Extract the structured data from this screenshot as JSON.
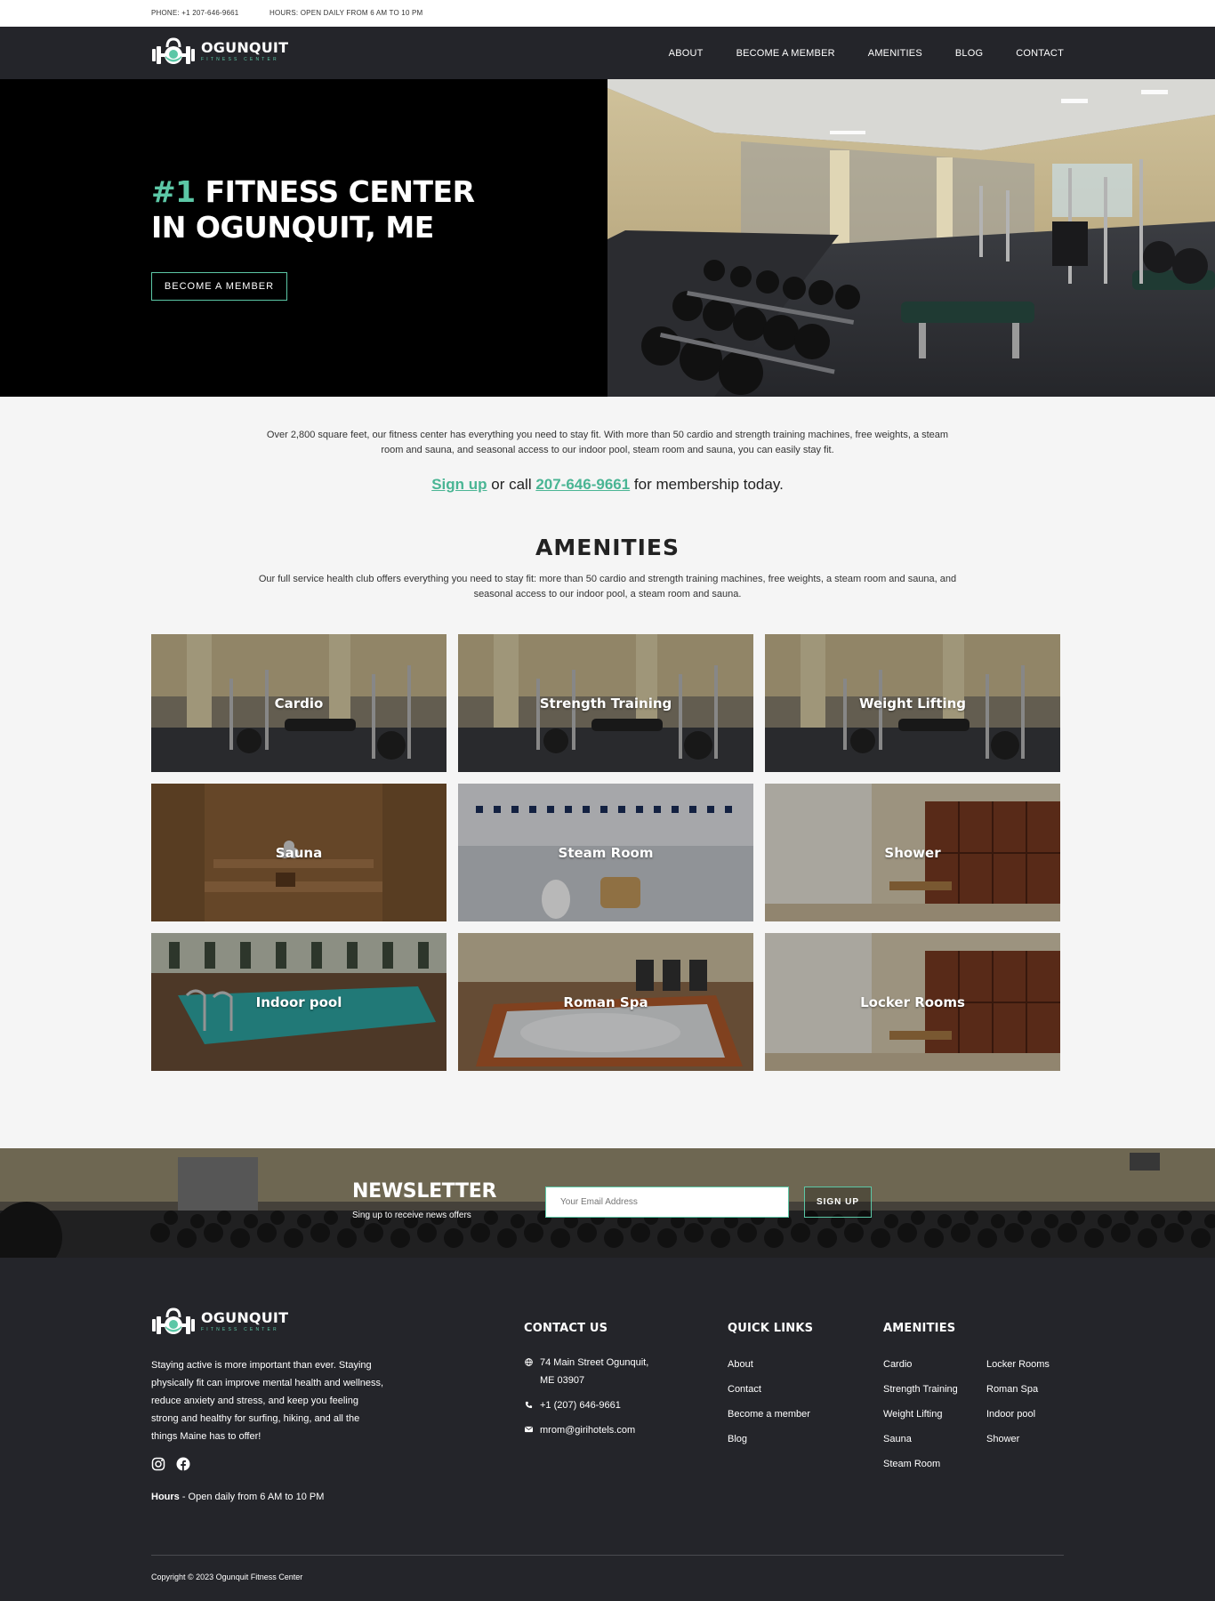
{
  "topbar": {
    "phone": "PHONE: +1 207-646-9661",
    "hours": "HOURS: OPEN DAILY FROM 6 AM TO 10 PM"
  },
  "brand": {
    "name": "OGUNQUIT",
    "tagline": "FITNESS CENTER",
    "accent_color": "#5cc7a6",
    "dark_color": "#24252a"
  },
  "nav": {
    "items": [
      "ABOUT",
      "BECOME A MEMBER",
      "AMENITIES",
      "BLOG",
      "CONTACT"
    ]
  },
  "hero": {
    "title_accent": "#1",
    "title_line1_rest": " FITNESS CENTER",
    "title_line2": "IN OGUNQUIT, ME",
    "button": "BECOME A MEMBER"
  },
  "intro": {
    "text": "Over 2,800 square feet, our fitness center has everything you need to stay fit. With more than 50 cardio and strength training machines, free weights, a steam room and sauna, and seasonal access to our indoor pool, steam room and sauna, you can easily stay fit.",
    "signup_link": "Sign up",
    "or_call": " or call ",
    "phone_link": " 207-646-9661",
    "suffix": " for membership today."
  },
  "amenities": {
    "title": "AMENITIES",
    "description": "Our full service health club offers everything you need to stay fit: more than 50 cardio and strength training machines, free weights, a steam room and sauna, and seasonal access to our indoor pool, a steam room and sauna.",
    "tiles": [
      {
        "label": "Cardio",
        "scene": "gym"
      },
      {
        "label": "Strength Training",
        "scene": "gym"
      },
      {
        "label": "Weight Lifting",
        "scene": "gym"
      },
      {
        "label": "Sauna",
        "scene": "wood"
      },
      {
        "label": "Steam Room",
        "scene": "tile"
      },
      {
        "label": "Shower",
        "scene": "locker"
      },
      {
        "label": "Indoor pool",
        "scene": "pool"
      },
      {
        "label": "Roman Spa",
        "scene": "spa"
      },
      {
        "label": "Locker Rooms",
        "scene": "locker"
      }
    ]
  },
  "newsletter": {
    "title": "NEWSLETTER",
    "subtitle": "Sing up to receive news offers",
    "placeholder": "Your Email Address",
    "button": "SIGN UP"
  },
  "footer": {
    "about": "Staying active is more important than ever. Staying physically fit can improve mental health and wellness, reduce anxiety and stress, and keep you feeling strong and healthy for surfing, hiking, and all the things Maine has to offer!",
    "hours_label": "Hours",
    "hours_text": " - Open daily from 6 AM to 10 PM",
    "contact_title": "CONTACT US",
    "address_line1": "74 Main Street Ogunquit,",
    "address_line2": "ME 03907",
    "phone": "+1 (207) 646-9661",
    "email": "mrom@girihotels.com",
    "quick_title": "QUICK LINKS",
    "quick_links": [
      "About",
      "Contact",
      "Become a member",
      "Blog"
    ],
    "amen_title": "AMENITIES",
    "amen_col1": [
      "Cardio",
      "Strength Training",
      "Weight Lifting",
      "Sauna",
      "Steam Room"
    ],
    "amen_col2": [
      "Locker Rooms",
      "Roman Spa",
      "Indoor pool",
      "Shower"
    ],
    "copyright": "Copyright © 2023 Ogunquit Fitness Center"
  }
}
